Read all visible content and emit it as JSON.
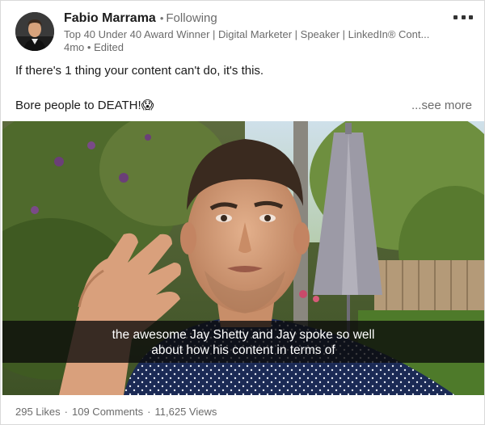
{
  "post": {
    "author": {
      "name": "Fabio Marrama",
      "follow_state": "Following",
      "headline": "Top 40 Under 40 Award Winner | Digital Marketer | Speaker | LinkedIn® Cont...",
      "meta": "4mo • Edited"
    },
    "text_line_1": "If there's 1 thing your content can't do, it's this.",
    "text_line_2": "Bore people to DEATH!😱",
    "see_more": "...see more",
    "video": {
      "caption_line_1": "the awesome Jay Shetty and Jay spoke so well",
      "caption_line_2": "about how his content in terms of"
    },
    "stats": {
      "likes": "295 Likes",
      "comments": "109 Comments",
      "views": "11,625 Views"
    }
  },
  "icons": {
    "more": "more-options-icon"
  },
  "colors": {
    "muted_text": "#6b6b6b",
    "caption_background": "#0a0a0a",
    "caption_text": "#ffffff"
  }
}
